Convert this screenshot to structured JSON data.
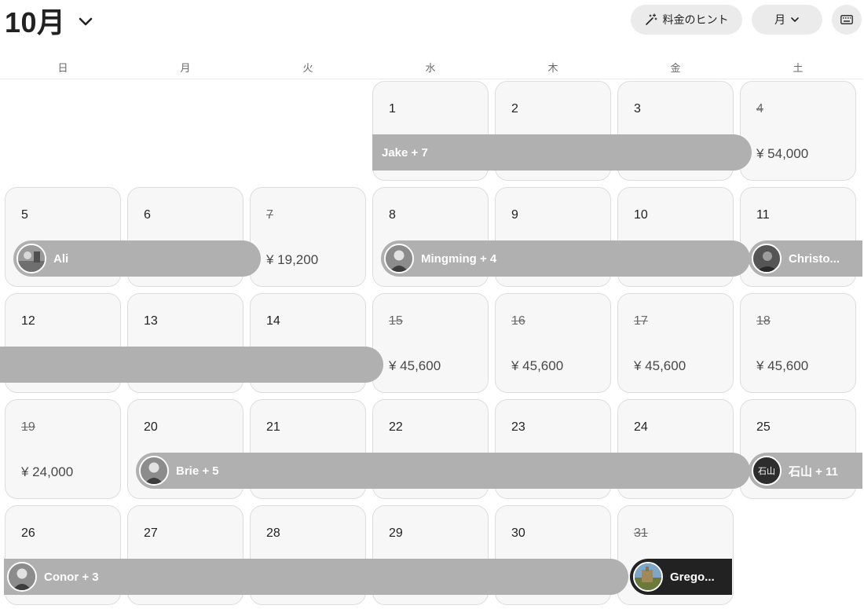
{
  "header": {
    "month_label": "10月",
    "pricing_tips_label": "料金のヒント",
    "view_label": "月"
  },
  "weekdays": [
    "日",
    "月",
    "火",
    "水",
    "木",
    "金",
    "土"
  ],
  "weeks": [
    {
      "days": [
        null,
        null,
        null,
        {
          "day": "1",
          "past": false,
          "price": ""
        },
        {
          "day": "2",
          "past": false,
          "price": ""
        },
        {
          "day": "3",
          "past": false,
          "price": ""
        },
        {
          "day": "4",
          "past": true,
          "price": "¥ 54,000"
        }
      ]
    },
    {
      "days": [
        {
          "day": "5",
          "past": false,
          "price": ""
        },
        {
          "day": "6",
          "past": false,
          "price": ""
        },
        {
          "day": "7",
          "past": true,
          "price": "¥ 19,200"
        },
        {
          "day": "8",
          "past": false,
          "price": ""
        },
        {
          "day": "9",
          "past": false,
          "price": ""
        },
        {
          "day": "10",
          "past": false,
          "price": ""
        },
        {
          "day": "11",
          "past": false,
          "price": ""
        }
      ]
    },
    {
      "days": [
        {
          "day": "12",
          "past": false,
          "price": ""
        },
        {
          "day": "13",
          "past": false,
          "price": ""
        },
        {
          "day": "14",
          "past": false,
          "price": ""
        },
        {
          "day": "15",
          "past": true,
          "price": "¥ 45,600"
        },
        {
          "day": "16",
          "past": true,
          "price": "¥ 45,600"
        },
        {
          "day": "17",
          "past": true,
          "price": "¥ 45,600"
        },
        {
          "day": "18",
          "past": true,
          "price": "¥ 45,600"
        }
      ]
    },
    {
      "days": [
        {
          "day": "19",
          "past": true,
          "price": "¥ 24,000"
        },
        {
          "day": "20",
          "past": false,
          "price": ""
        },
        {
          "day": "21",
          "past": false,
          "price": ""
        },
        {
          "day": "22",
          "past": false,
          "price": ""
        },
        {
          "day": "23",
          "past": false,
          "price": ""
        },
        {
          "day": "24",
          "past": false,
          "price": ""
        },
        {
          "day": "25",
          "past": false,
          "price": ""
        }
      ]
    },
    {
      "days": [
        {
          "day": "26",
          "past": false,
          "price": ""
        },
        {
          "day": "27",
          "past": false,
          "price": ""
        },
        {
          "day": "28",
          "past": false,
          "price": ""
        },
        {
          "day": "29",
          "past": false,
          "price": ""
        },
        {
          "day": "30",
          "past": false,
          "price": ""
        },
        {
          "day": "31",
          "past": true,
          "price": ""
        },
        null
      ]
    }
  ],
  "reservations": [
    {
      "guest": "Jake + 7",
      "avatar": "none",
      "color": "#b0b0b0"
    },
    {
      "guest": "Ali",
      "avatar": "photo-outdoor",
      "color": "#b0b0b0"
    },
    {
      "guest": "Mingming + 4",
      "avatar": "photo-person",
      "color": "#b0b0b0"
    },
    {
      "guest": "Christo...",
      "avatar": "photo-dark",
      "color": "#b0b0b0"
    },
    {
      "guest": "",
      "avatar": "none",
      "color": "#b0b0b0"
    },
    {
      "guest": "Brie + 5",
      "avatar": "photo-person",
      "color": "#b0b0b0"
    },
    {
      "guest": "石山 + 11",
      "avatar": "initials",
      "initials": "石山",
      "color": "#b0b0b0"
    },
    {
      "guest": "Conor + 3",
      "avatar": "photo-person",
      "color": "#b0b0b0"
    },
    {
      "guest": "Grego...",
      "avatar": "photo-landscape",
      "color": "#222222"
    }
  ],
  "colors": {
    "bar": "#b0b0b0",
    "bar_active": "#222222",
    "cell_bg": "#f7f7f7",
    "cell_border": "#dddddd",
    "pill_bg": "#ebebeb"
  },
  "icons": [
    "chevron-down-icon",
    "magic-wand-icon",
    "keyboard-icon"
  ]
}
